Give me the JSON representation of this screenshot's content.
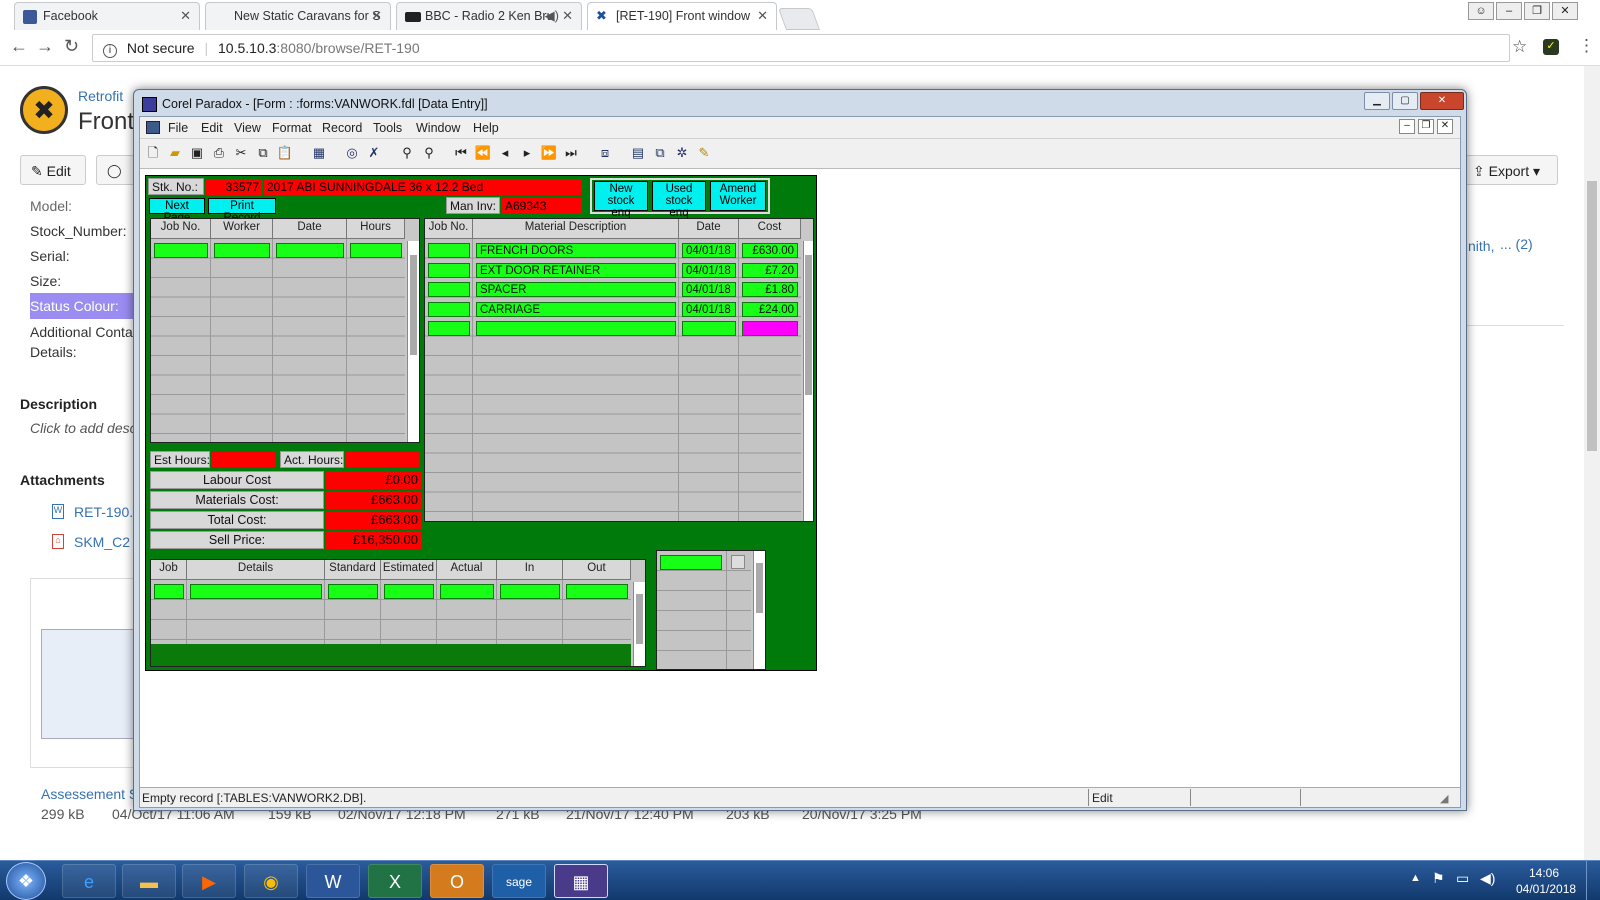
{
  "browser": {
    "tabs": [
      {
        "title": "Facebook",
        "color": "#3b5998"
      },
      {
        "title": "New Static Caravans for S",
        "color": "#eeeeee"
      },
      {
        "title": "BBC - Radio 2 Ken Bru",
        "color": "#222222"
      },
      {
        "title": "[RET-190] Front window",
        "color": "#eeeeee"
      }
    ],
    "security": "Not secure",
    "url_host": "10.5.10.3",
    "url_rest": ":8080/browse/RET-190"
  },
  "jira": {
    "project": "Retrofit",
    "title_fragment": "Front",
    "edit_label": "Edit",
    "export_label": "Export",
    "fields": [
      "Model:",
      "Stock_Number:",
      "Serial:",
      "Size:",
      "Status Colour:",
      "Additional Conta",
      "Details:"
    ],
    "description_heading": "Description",
    "description_placeholder": "Click to add desc",
    "attachments_heading": "Attachments",
    "attachments": [
      "RET-190.",
      "SKM_C2"
    ],
    "assessment_label": "Assessement S",
    "file_meta": [
      {
        "size": "299 kB",
        "date": "04/Oct/17 11:06 AM"
      },
      {
        "size": "159 kB",
        "date": "02/Nov/17 12:18 PM"
      },
      {
        "size": "271 kB",
        "date": "21/Nov/17 12:40 PM"
      },
      {
        "size": "203 kB",
        "date": "20/Nov/17 3:25 PM"
      }
    ],
    "right_fragment": "nith,",
    "right_more": "... (2)"
  },
  "paradox": {
    "title": "Corel Paradox - [Form : :forms:VANWORK.fdl [Data Entry]]",
    "menu": [
      "File",
      "Edit",
      "View",
      "Format",
      "Record",
      "Tools",
      "Window",
      "Help"
    ],
    "status_text": "Empty record [:TABLES:VANWORK2.DB].",
    "status_mode": "Edit",
    "form": {
      "stk_label": "Stk. No.:",
      "stk_no": "33577",
      "van_desc": "2017 ABI SUNNINGDALE 36 x 12.2 Bed",
      "next_page": "Next Page",
      "print_record": "Print Record",
      "man_inv_label": "Man Inv:",
      "man_inv": "A69343",
      "btn_new": [
        "New",
        "stock enq"
      ],
      "btn_used": [
        "Used",
        "stock enq"
      ],
      "btn_amend": [
        "Amend",
        "Worker"
      ],
      "labour_headers": [
        "Job No.",
        "Worker",
        "Date",
        "Hours"
      ],
      "material_headers": [
        "Job No.",
        "Material Description",
        "Date",
        "Cost"
      ],
      "materials": [
        {
          "desc": "FRENCH DOORS",
          "date": "04/01/18",
          "cost": "£630.00"
        },
        {
          "desc": "EXT DOOR RETAINER",
          "date": "04/01/18",
          "cost": "£7.20"
        },
        {
          "desc": "SPACER",
          "date": "04/01/18",
          "cost": "£1.80"
        },
        {
          "desc": "CARRIAGE",
          "date": "04/01/18",
          "cost": "£24.00"
        }
      ],
      "est_hours_label": "Est Hours:",
      "act_hours_label": "Act. Hours:",
      "labour_cost_label": "Labour Cost",
      "labour_cost": "£0.00",
      "materials_cost_label": "Materials Cost:",
      "materials_cost": "£663.00",
      "total_cost_label": "Total Cost:",
      "total_cost": "£663.00",
      "sell_price_label": "Sell Price:",
      "sell_price": "£16,350.00",
      "job_headers": [
        "Job",
        "Details",
        "Standard",
        "Estimated",
        "Actual",
        "In",
        "Out"
      ]
    }
  },
  "taskbar": {
    "time": "14:06",
    "date": "04/01/2018"
  }
}
